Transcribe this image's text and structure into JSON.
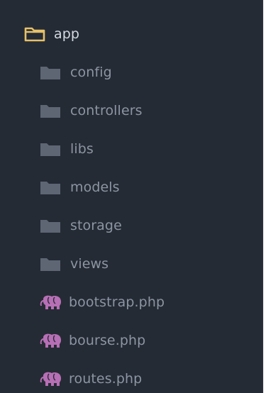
{
  "tree": {
    "root": {
      "label": "app",
      "icon": "folder-open-icon",
      "icon_color": "#e6c16a"
    },
    "folders": [
      {
        "label": "config",
        "icon": "folder-icon"
      },
      {
        "label": "controllers",
        "icon": "folder-icon"
      },
      {
        "label": "libs",
        "icon": "folder-icon"
      },
      {
        "label": "models",
        "icon": "folder-icon"
      },
      {
        "label": "storage",
        "icon": "folder-icon"
      },
      {
        "label": "views",
        "icon": "folder-icon"
      }
    ],
    "files": [
      {
        "label": "bootstrap.php",
        "icon": "php-elephant-icon"
      },
      {
        "label": "bourse.php",
        "icon": "php-elephant-icon"
      },
      {
        "label": "routes.php",
        "icon": "php-elephant-icon"
      }
    ],
    "colors": {
      "background": "#252b35",
      "folder_icon": "#5e6674",
      "php_icon": "#b76fb5",
      "root_text": "#d5dae2",
      "child_text": "#8c95a2"
    }
  }
}
